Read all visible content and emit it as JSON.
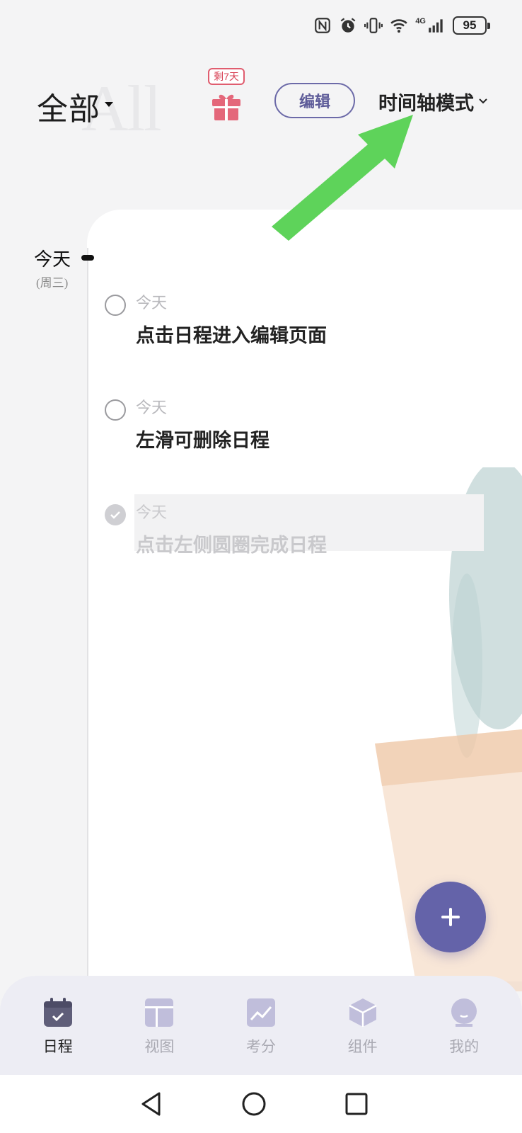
{
  "status_bar": {
    "network": "4G",
    "battery": "95",
    "icons": [
      "nfc-icon",
      "alarm-icon",
      "vibrate-icon",
      "wifi-icon",
      "signal-icon",
      "battery-icon"
    ]
  },
  "header": {
    "title": "全部",
    "title_bg": "All",
    "gift_badge": "剩7天",
    "edit_label": "编辑",
    "mode_label": "时间轴模式"
  },
  "timeline": {
    "day_label": "今天",
    "day_sub": "(周三)"
  },
  "tasks": [
    {
      "date": "今天",
      "title": "点击日程进入编辑页面",
      "done": false
    },
    {
      "date": "今天",
      "title": "左滑可删除日程",
      "done": false
    },
    {
      "date": "今天",
      "title": "点击左侧圆圈完成日程",
      "done": true
    }
  ],
  "bottom_nav": [
    {
      "label": "日程",
      "icon": "calendar-icon",
      "active": true
    },
    {
      "label": "视图",
      "icon": "layout-icon",
      "active": false
    },
    {
      "label": "考分",
      "icon": "chart-icon",
      "active": false
    },
    {
      "label": "组件",
      "icon": "cube-icon",
      "active": false
    },
    {
      "label": "我的",
      "icon": "profile-icon",
      "active": false
    }
  ],
  "colors": {
    "accent": "#6463a9",
    "gift": "#e05d6f",
    "annotation_arrow": "#5ed35a"
  }
}
